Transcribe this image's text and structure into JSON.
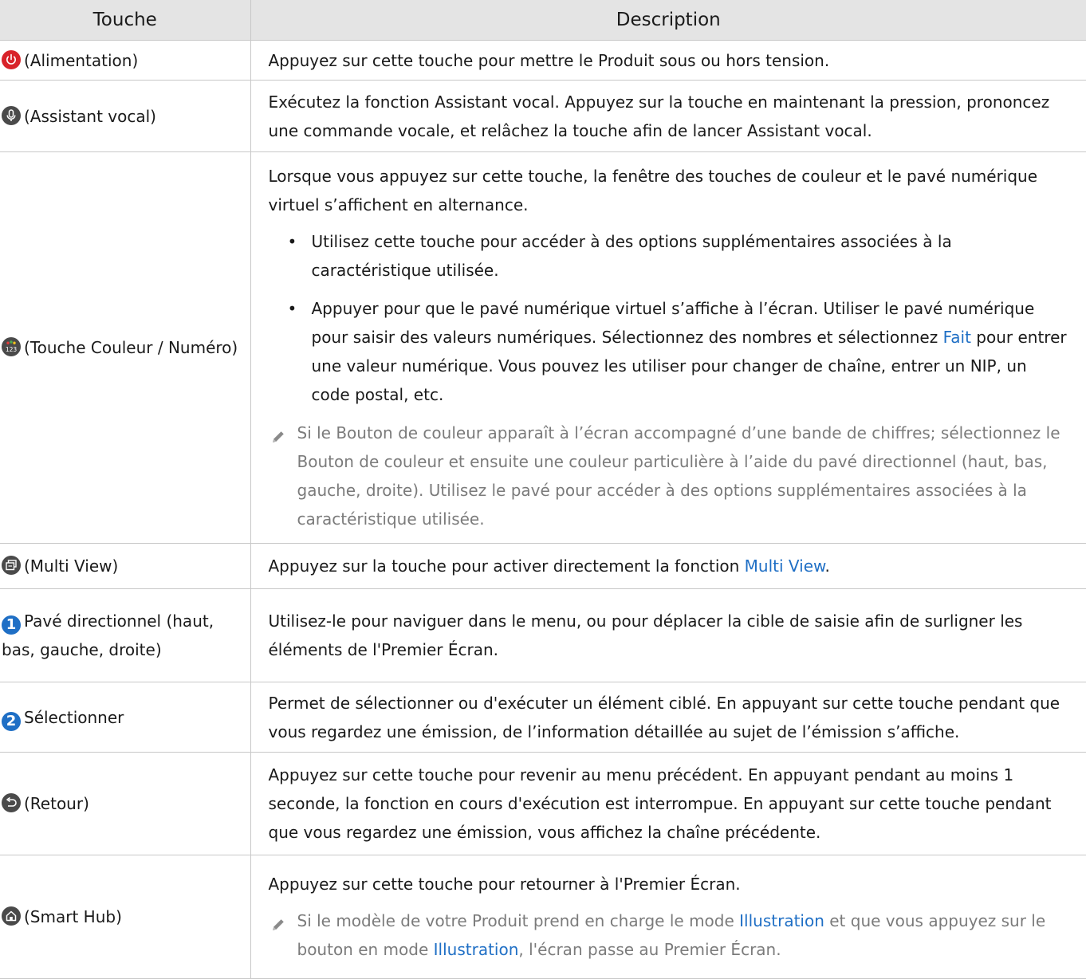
{
  "header": {
    "col_key": "Touche",
    "col_desc": "Description"
  },
  "rows": {
    "power": {
      "icon": "power-icon",
      "label": "(Alimentation)",
      "desc": "Appuyez sur cette touche pour mettre le Produit sous ou hors tension."
    },
    "voice": {
      "icon": "microphone-icon",
      "label": "(Assistant vocal)",
      "desc": "Exécutez la fonction Assistant vocal. Appuyez sur la touche en maintenant la pression, prononcez une commande vocale, et relâchez la touche afin de lancer Assistant vocal."
    },
    "color": {
      "icon": "color-number-icon",
      "label": "(Touche Couleur / Numéro)",
      "intro": "Lorsque vous appuyez sur cette touche, la fenêtre des touches de couleur et le pavé numérique virtuel s’affichent en alternance.",
      "bullet1": "Utilisez cette touche pour accéder à des options supplémentaires associées à la caractéristique utilisée.",
      "bullet2_a": "Appuyer pour que le pavé numérique virtuel s’affiche à l’écran. Utiliser le pavé numérique pour saisir des valeurs numériques. Sélectionnez des nombres et sélectionnez",
      "bullet2_link": "Fait",
      "bullet2_b": "pour entrer une valeur numérique. Vous pouvez les utiliser pour changer de chaîne, entrer un NIP, un code postal, etc.",
      "note": "Si le Bouton de couleur apparaît à l’écran accompagné d’une bande de chiffres; sélectionnez le Bouton de couleur et ensuite une couleur particulière à l’aide du pavé directionnel (haut, bas, gauche, droite). Utilisez le pavé pour accéder à des options supplémentaires associées à la caractéristique utilisée."
    },
    "multiview": {
      "icon": "multi-view-icon",
      "label": "(Multi View)",
      "desc_a": "Appuyez sur la touche pour activer directement la fonction",
      "desc_link": "Multi View",
      "desc_b": "."
    },
    "dpad": {
      "number": "1",
      "label": "Pavé directionnel (haut, bas, gauche, droite)",
      "desc": "Utilisez-le pour naviguer dans le menu, ou pour déplacer la cible de saisie afin de surligner les éléments de l'Premier Écran."
    },
    "select": {
      "number": "2",
      "label": "Sélectionner",
      "desc": "Permet de sélectionner ou d'exécuter un élément ciblé. En appuyant sur cette touche pendant que vous regardez une émission, de l’information détaillée au sujet de l’émission s’affiche."
    },
    "back": {
      "icon": "return-icon",
      "label": "(Retour)",
      "desc": "Appuyez sur cette touche pour revenir au menu précédent. En appuyant pendant au moins 1 seconde, la fonction en cours d'exécution est interrompue. En appuyant sur cette touche pendant que vous regardez une émission, vous affichez la chaîne précédente."
    },
    "home": {
      "icon": "home-icon",
      "label": "(Smart Hub)",
      "desc": "Appuyez sur cette touche pour retourner à l'Premier Écran.",
      "note_a": "Si le modèle de votre Produit prend en charge le mode",
      "note_link1": "Illustration",
      "note_b": "et que vous appuyez sur le bouton en mode",
      "note_link2": "Illustration",
      "note_c": ", l'écran passe au Premier Écran."
    }
  },
  "colors": {
    "accent": "#1f6fc5",
    "power": "#d8232a",
    "icon_dark": "#4a4a4a",
    "header_bg": "#e4e4e4",
    "note_text": "#7b7b7b"
  }
}
